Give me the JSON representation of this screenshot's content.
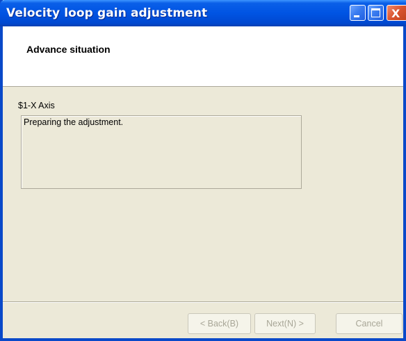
{
  "window": {
    "title": "Velocity loop gain adjustment",
    "icons": {
      "minimize": "minimize-icon",
      "maximize": "maximize-icon",
      "close": "close-icon"
    },
    "close_glyph": "X"
  },
  "header": {
    "title": "Advance situation"
  },
  "main": {
    "axis_label": "$1-X Axis",
    "status_text": "Preparing the adjustment."
  },
  "buttons": {
    "back_label": "< Back(B)",
    "next_label": "Next(N) >",
    "cancel_label": "Cancel"
  },
  "colors": {
    "titlebar": "#0054e3",
    "dialog_bg": "#ece9d8",
    "header_bg": "#ffffff",
    "disabled_text": "#a8a697"
  }
}
